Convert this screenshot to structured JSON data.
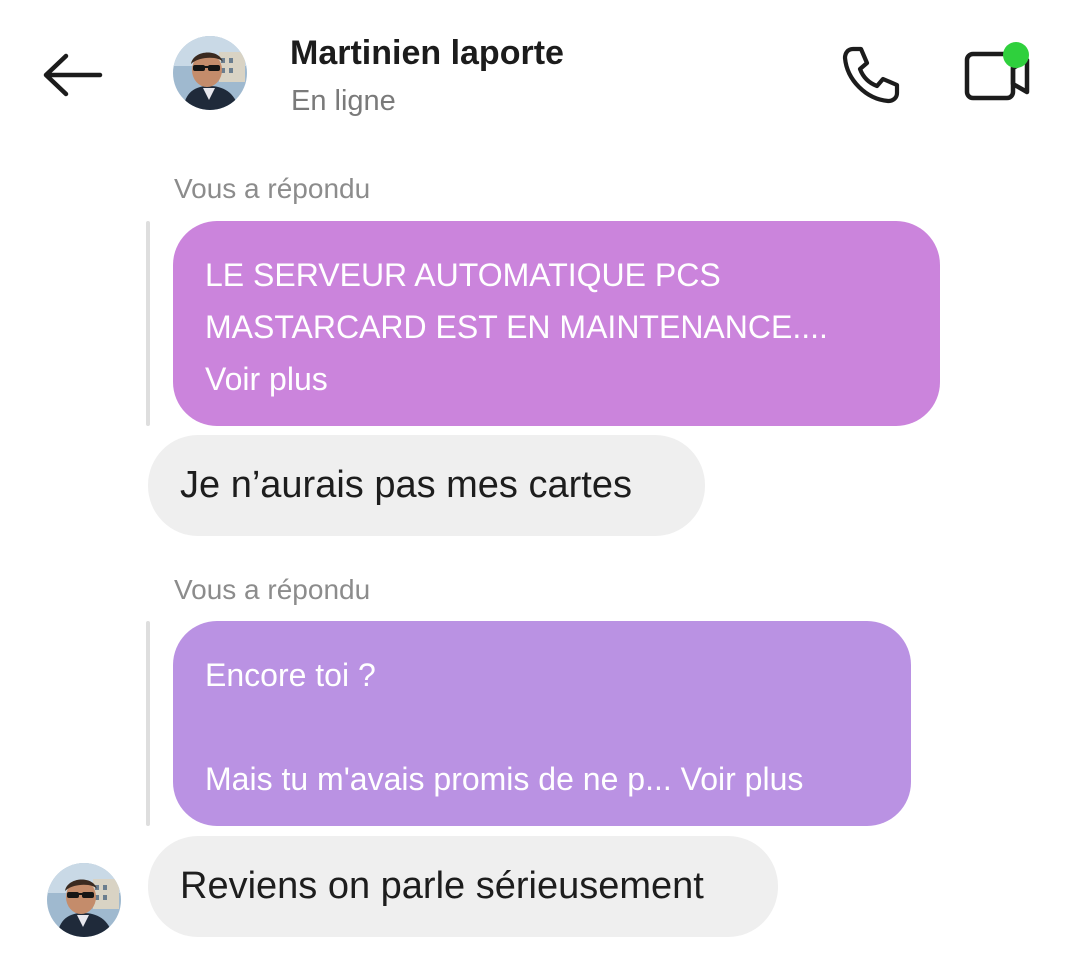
{
  "header": {
    "contact_name": "Martinien laporte",
    "status": "En ligne",
    "online_color": "#2fd03d"
  },
  "messages": [
    {
      "reply_label": "Vous a répondu",
      "quoted_lines": [
        "LE SERVEUR AUTOMATIQUE PCS",
        "MASTARCARD EST EN MAINTENANCE....",
        "Voir plus"
      ],
      "quoted_color": "#cb84dc",
      "text": "Je n’aurais pas mes cartes"
    },
    {
      "reply_label": "Vous a répondu",
      "quoted_lines": [
        "Encore toi ?",
        "",
        "Mais tu m'avais promis de ne p... Voir plus"
      ],
      "quoted_color": "#ba92e3",
      "text": "Reviens on parle sérieusement"
    }
  ],
  "icons": {
    "back": "arrow-left-icon",
    "call": "phone-icon",
    "video": "video-camera-icon"
  }
}
